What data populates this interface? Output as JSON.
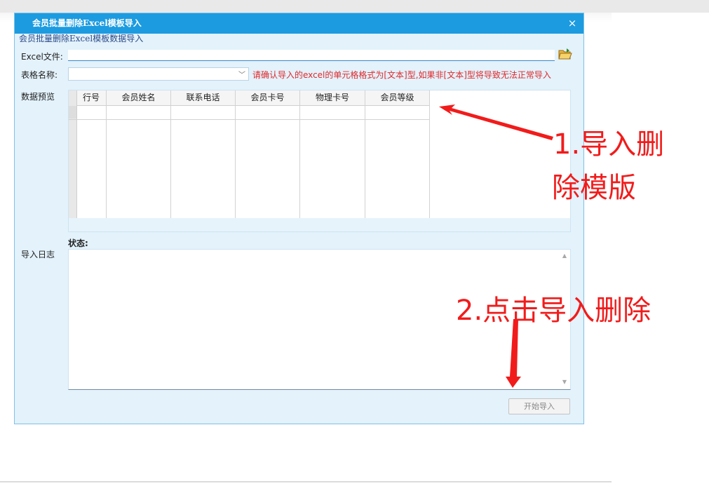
{
  "dialog": {
    "title": "会员批量删除Excel模板导入",
    "close_symbol": "×",
    "group_legend": "会员批量删除Excel模板数据导入"
  },
  "form": {
    "excel_label": "Excel文件:",
    "excel_value": "",
    "sheet_label": "表格名称:",
    "sheet_value": "",
    "warning": "请确认导入的excel的单元格格式为[文本]型,如果非[文本]型将导致无法正常导入",
    "preview_label": "数据预览",
    "log_label": "导入日志",
    "status_label": "状态:"
  },
  "grid": {
    "columns": [
      "行号",
      "会员姓名",
      "联系电话",
      "会员卡号",
      "物理卡号",
      "会员等级"
    ]
  },
  "buttons": {
    "start_import": "开始导入"
  },
  "annotations": {
    "step1_line1": "1.导入删",
    "step1_line2": "除模版",
    "step2": "2.点击导入删除",
    "color": "#f21b1b"
  }
}
